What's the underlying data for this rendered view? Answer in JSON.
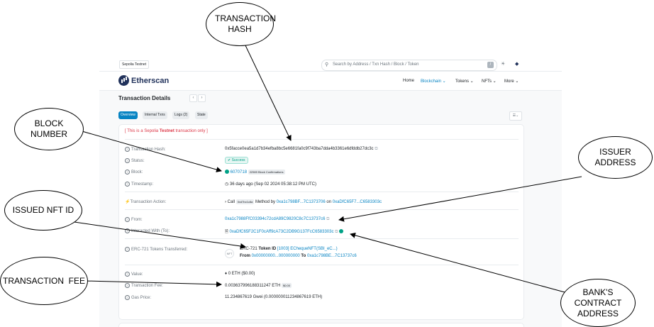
{
  "topbar": {
    "network_badge": "Sepolia Testnet",
    "search_placeholder": "Search by Address / Txn Hash / Block / Token",
    "search_key_hint": "/"
  },
  "navbar": {
    "brand": "Etherscan",
    "items": [
      {
        "label": "Home"
      },
      {
        "label": "Blockchain ⌄"
      },
      {
        "label": "Tokens ⌄"
      },
      {
        "label": "NFTs ⌄"
      },
      {
        "label": "More ⌄"
      }
    ]
  },
  "page": {
    "title": "Transaction Details",
    "tabs": [
      {
        "label": "Overview"
      },
      {
        "label": "Internal Txns"
      },
      {
        "label": "Logs (2)"
      },
      {
        "label": "State"
      }
    ]
  },
  "details": {
    "notice_prefix": "[ This is a Sepolia ",
    "notice_bold": "Testnet",
    "notice_suffix": " transaction only ]",
    "rows": {
      "hash": {
        "label": "Transaction Hash:",
        "value": "0x5facce0ea5a1d7b34efba8bc5e6681fa0c9f743ba7dda4b3361e6dfddb27dc3c"
      },
      "status": {
        "label": "Status:",
        "value": "Success"
      },
      "block": {
        "label": "Block:",
        "value": "6070718",
        "confirmations": "22989 Block Confirmations"
      },
      "timestamp": {
        "label": "Timestamp:",
        "value": "36 days ago (Sep 02 2024 05:38:12 PM UTC)"
      },
      "action": {
        "label": "Transaction Action:",
        "call": "Call",
        "method_badge": "0xd7bc1c8a",
        "method_text": "Method by",
        "by_address": "0xa1c798BF...7C1373706",
        "on_text": "on",
        "on_address": "0xaDfC65F7...C6583303c"
      },
      "from": {
        "label": "From:",
        "value": "0xa1c7988FfC03394c72cdA89C9820C8c7C13737c6"
      },
      "interacted": {
        "label": "Interacted With (To):",
        "value": "0xaDfC65F2C1F0cAff9cA73C2DB9G137FcC6583303c"
      },
      "tokens": {
        "label": "ERC-721 Tokens Transferred:",
        "thumb": "NFT",
        "standard": "ERC-721",
        "token_id_text": "Token ID",
        "token_id": "[1003]",
        "token_name": "EChequeNFT(SBI_eC...)",
        "from_text": "From",
        "from_address": "0x00000000...000000000",
        "to_text": "To",
        "to_address": "0xa1c798BE...7C13737c6"
      },
      "value": {
        "label": "Value:",
        "value": "0 ETH ($0.00)"
      },
      "fee": {
        "label": "Transaction Fee:",
        "value": "0.003637996188311247 ETH",
        "usd": "$0.00"
      },
      "gas": {
        "label": "Gas Price:",
        "value": "11.234867619 Gwei (0.000000011234867619 ETH)"
      }
    }
  },
  "callouts": {
    "tx_hash": "TRANSACTION HASH",
    "block_number": "BLOCK NUMBER",
    "issuer_address": "ISSUER ADDRESS",
    "issued_nft_id": "ISSUED NFT ID",
    "transaction_fee": "TRANSACTION  FEE",
    "bank_contract": "BANK'S CONTRACT ADDRESS"
  }
}
